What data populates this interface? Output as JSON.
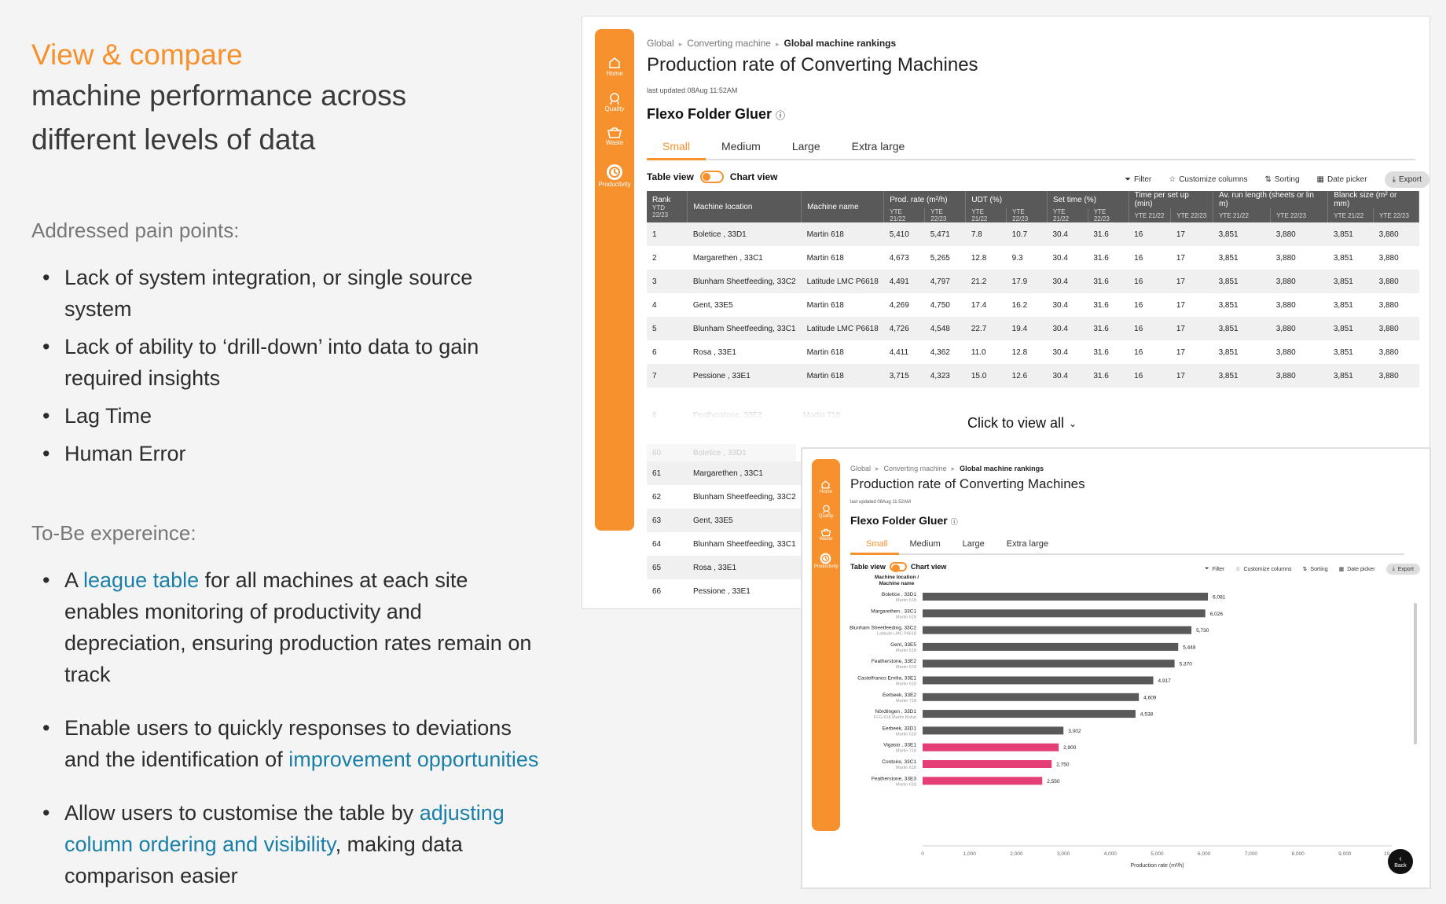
{
  "left": {
    "headline": "View & compare",
    "subline1": "machine performance across",
    "subline2": "different levels of data",
    "pain_title": "Addressed pain points:",
    "pain": [
      "Lack of system integration, or single source system",
      "Lack of ability to ‘drill-down’ into data to gain required insights",
      "Lag Time",
      "Human Error"
    ],
    "tobe_title": "To-Be expereince:",
    "tobe1_a": "A ",
    "tobe1_hl": "league table",
    "tobe1_b": " for all machines at each site enables monitoring of productivity and depreciation, ensuring production rates remain on track",
    "tobe2_a": "Enable users to quickly responses to deviations and the identification of ",
    "tobe2_hl": "improvement opportunities",
    "tobe3_a": "Allow users to customise the table by ",
    "tobe3_hl": "adjusting column ordering and visibility",
    "tobe3_b": ", making data comparison easier"
  },
  "nav": {
    "home": "Home",
    "quality": "Quality",
    "waste": "Waste",
    "productivity": "Productivity"
  },
  "crumb": {
    "c1": "Global",
    "c2": "Converting machine",
    "c3": "Global machine rankings"
  },
  "title": "Production rate of Converting Machines",
  "updated": "last updated 08Aug 11:52AM",
  "machine": "Flexo Folder Gluer",
  "tabs": [
    "Small",
    "Medium",
    "Large",
    "Extra large"
  ],
  "view": {
    "table": "Table view",
    "chart": "Chart view"
  },
  "tools": {
    "filter": "Filter",
    "columns": "Customize columns",
    "sorting": "Sorting",
    "date": "Date picker",
    "export": "Export"
  },
  "table": {
    "headers": {
      "rank": "Rank",
      "rank_sub": "YTD 22/23",
      "loc": "Machine location",
      "name": "Machine name",
      "prod": "Prod. rate (m²/h)",
      "udt": "UDT (%)",
      "set": "Set time (%)",
      "tps": "Time per set up (min)",
      "avr": "Av. run length (sheets or lin m)",
      "bs": "Blanck size (m² or mm)",
      "p1": "YTE 21/22",
      "p2": "YTE 22/23"
    },
    "rows": [
      [
        "1",
        "Boletice , 33D1",
        "Martin 618",
        "5,410",
        "5,471",
        "7.8",
        "10.7",
        "30.4",
        "31.6",
        "16",
        "17",
        "3,851",
        "3,880",
        "3,851",
        "3,880"
      ],
      [
        "2",
        "Margarethen , 33C1",
        "Martin 618",
        "4,673",
        "5,265",
        "12.8",
        "9.3",
        "30.4",
        "31.6",
        "16",
        "17",
        "3,851",
        "3,880",
        "3,851",
        "3,880"
      ],
      [
        "3",
        "Blunham Sheetfeeding, 33C2",
        "Latitude LMC P6618",
        "4,491",
        "4,797",
        "21.2",
        "17.9",
        "30.4",
        "31.6",
        "16",
        "17",
        "3,851",
        "3,880",
        "3,851",
        "3,880"
      ],
      [
        "4",
        "Gent, 33E5",
        "Martin 618",
        "4,269",
        "4,750",
        "17.4",
        "16.2",
        "30.4",
        "31.6",
        "16",
        "17",
        "3,851",
        "3,880",
        "3,851",
        "3,880"
      ],
      [
        "5",
        "Blunham Sheetfeeding, 33C1",
        "Latitude LMC P6618",
        "4,726",
        "4,548",
        "22.7",
        "19.4",
        "30.4",
        "31.6",
        "16",
        "17",
        "3,851",
        "3,880",
        "3,851",
        "3,880"
      ],
      [
        "6",
        "Rosa , 33E1",
        "Martin 618",
        "4,411",
        "4,362",
        "11.0",
        "12.8",
        "30.4",
        "31.6",
        "16",
        "17",
        "3,851",
        "3,880",
        "3,851",
        "3,880"
      ],
      [
        "7",
        "Pessione , 33E1",
        "Martin 618",
        "3,715",
        "4,323",
        "15.0",
        "12.6",
        "30.4",
        "31.6",
        "16",
        "17",
        "3,851",
        "3,880",
        "3,851",
        "3,880"
      ]
    ],
    "faded": [
      "8",
      "Featherstone, 33E2",
      "Martin 718",
      "60",
      "Boletice , 33D1"
    ],
    "view_all": "Click to view all",
    "lower": [
      [
        "61",
        "Margarethen , 33C1"
      ],
      [
        "62",
        "Blunham Sheetfeeding, 33C2"
      ],
      [
        "63",
        "Gent, 33E5"
      ],
      [
        "64",
        "Blunham Sheetfeeding, 33C1"
      ],
      [
        "65",
        "Rosa , 33E1"
      ],
      [
        "66",
        "Pessione , 33E1"
      ]
    ]
  },
  "back": "Back",
  "chart_data": {
    "type": "bar",
    "orientation": "horizontal",
    "ylabel": "Machine location / Machine name",
    "xlabel": "Production rate (m²/h)",
    "xlim": [
      0,
      10000
    ],
    "xticks": [
      "0",
      "1,000",
      "2,000",
      "3,000",
      "4,000",
      "5,000",
      "6,000",
      "7,000",
      "8,000",
      "9,000",
      "10,000"
    ],
    "categories": [
      {
        "loc": "Boletice , 33D1",
        "name": "Martin 618"
      },
      {
        "loc": "Margarethen , 33C1",
        "name": "Martin 618"
      },
      {
        "loc": "Blunham Sheetfeeding, 33C2",
        "name": "Latitude LMC P6618"
      },
      {
        "loc": "Gent, 33E5",
        "name": "Martin 618"
      },
      {
        "loc": "Featherstone, 33E2",
        "name": "Martin 618"
      },
      {
        "loc": "Castelfranco Emilia, 33E1",
        "name": "Martin 618"
      },
      {
        "loc": "Eerbeek, 33E2",
        "name": "Martin 718"
      },
      {
        "loc": "Nördlingen , 33D1",
        "name": "FFG 618 Martin Bobst"
      },
      {
        "loc": "Eerbeek, 33D1",
        "name": "Martin 618"
      },
      {
        "loc": "Vigasio , 33E1",
        "name": "Martin 718"
      },
      {
        "loc": "Contoire, 33C1",
        "name": "Martin 618"
      },
      {
        "loc": "Featherstone, 33E3",
        "name": "Martin 618"
      }
    ],
    "values": [
      6081,
      6026,
      5730,
      5448,
      5370,
      4917,
      4609,
      4538,
      3002,
      2900,
      2750,
      2550
    ],
    "labels": [
      "6,081",
      "6,026",
      "5,730",
      "5,448",
      "5,370",
      "4,917",
      "4,609",
      "4,538",
      "3,002",
      "2,900",
      "2,750",
      "2,550"
    ],
    "highlight": [
      false,
      false,
      false,
      false,
      false,
      false,
      false,
      false,
      false,
      true,
      true,
      true
    ],
    "colors": {
      "normal": "#595959",
      "highlight": "#e53d75"
    }
  }
}
